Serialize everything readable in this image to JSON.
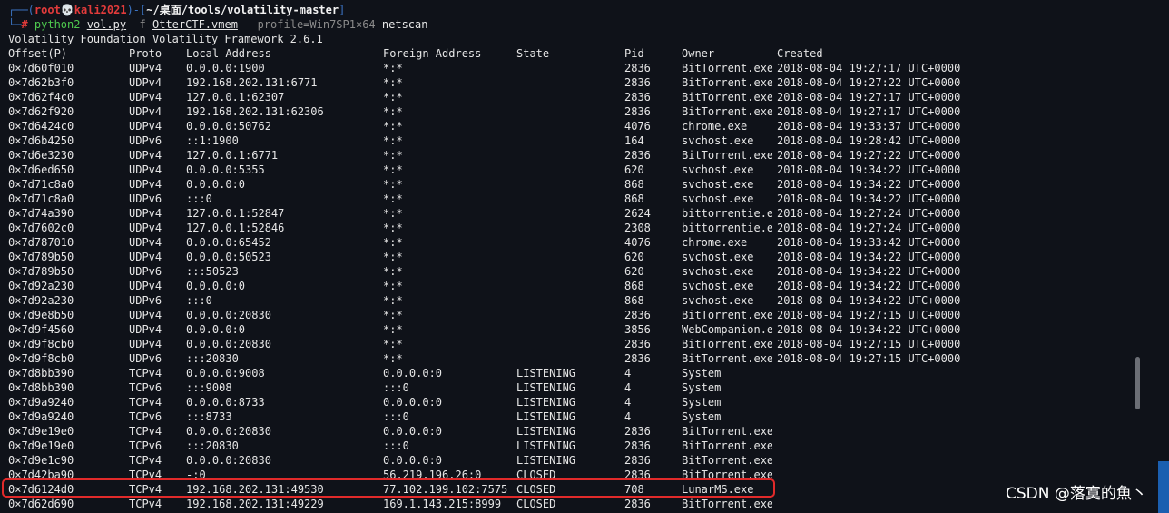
{
  "prompt": {
    "frame_top": "┌──(",
    "user": "root",
    "skull": "💀",
    "host": "kali2021",
    "sep": ")-[",
    "path": "~/桌面/tools/volatility-master",
    "frame_close": "]",
    "frame_bottom": "└─",
    "hash": "# ",
    "cmd_python": "python2",
    "cmd_script": "vol.py",
    "cmd_flag": "-f",
    "cmd_file": "OtterCTF.vmem",
    "cmd_profile": "--profile=Win7SP1×64",
    "cmd_plugin": "netscan"
  },
  "banner": "Volatility Foundation Volatility Framework 2.6.1",
  "table": {
    "headers": {
      "offset": "Offset(P)",
      "proto": "Proto",
      "local": "Local Address",
      "foreign": "Foreign Address",
      "state": "State",
      "pid": "Pid",
      "owner": "Owner",
      "created": "Created"
    },
    "rows": [
      {
        "offset": "0×7d60f010",
        "proto": "UDPv4",
        "local": "0.0.0.0:1900",
        "foreign": "*:*",
        "state": "",
        "pid": "2836",
        "owner": "BitTorrent.exe",
        "created": "2018-08-04 19:27:17 UTC+0000"
      },
      {
        "offset": "0×7d62b3f0",
        "proto": "UDPv4",
        "local": "192.168.202.131:6771",
        "foreign": "*:*",
        "state": "",
        "pid": "2836",
        "owner": "BitTorrent.exe",
        "created": "2018-08-04 19:27:22 UTC+0000"
      },
      {
        "offset": "0×7d62f4c0",
        "proto": "UDPv4",
        "local": "127.0.0.1:62307",
        "foreign": "*:*",
        "state": "",
        "pid": "2836",
        "owner": "BitTorrent.exe",
        "created": "2018-08-04 19:27:17 UTC+0000"
      },
      {
        "offset": "0×7d62f920",
        "proto": "UDPv4",
        "local": "192.168.202.131:62306",
        "foreign": "*:*",
        "state": "",
        "pid": "2836",
        "owner": "BitTorrent.exe",
        "created": "2018-08-04 19:27:17 UTC+0000"
      },
      {
        "offset": "0×7d6424c0",
        "proto": "UDPv4",
        "local": "0.0.0.0:50762",
        "foreign": "*:*",
        "state": "",
        "pid": "4076",
        "owner": "chrome.exe",
        "created": "2018-08-04 19:33:37 UTC+0000"
      },
      {
        "offset": "0×7d6b4250",
        "proto": "UDPv6",
        "local": "::1:1900",
        "foreign": "*:*",
        "state": "",
        "pid": "164",
        "owner": "svchost.exe",
        "created": "2018-08-04 19:28:42 UTC+0000"
      },
      {
        "offset": "0×7d6e3230",
        "proto": "UDPv4",
        "local": "127.0.0.1:6771",
        "foreign": "*:*",
        "state": "",
        "pid": "2836",
        "owner": "BitTorrent.exe",
        "created": "2018-08-04 19:27:22 UTC+0000"
      },
      {
        "offset": "0×7d6ed650",
        "proto": "UDPv4",
        "local": "0.0.0.0:5355",
        "foreign": "*:*",
        "state": "",
        "pid": "620",
        "owner": "svchost.exe",
        "created": "2018-08-04 19:34:22 UTC+0000"
      },
      {
        "offset": "0×7d71c8a0",
        "proto": "UDPv4",
        "local": "0.0.0.0:0",
        "foreign": "*:*",
        "state": "",
        "pid": "868",
        "owner": "svchost.exe",
        "created": "2018-08-04 19:34:22 UTC+0000"
      },
      {
        "offset": "0×7d71c8a0",
        "proto": "UDPv6",
        "local": ":::0",
        "foreign": "*:*",
        "state": "",
        "pid": "868",
        "owner": "svchost.exe",
        "created": "2018-08-04 19:34:22 UTC+0000"
      },
      {
        "offset": "0×7d74a390",
        "proto": "UDPv4",
        "local": "127.0.0.1:52847",
        "foreign": "*:*",
        "state": "",
        "pid": "2624",
        "owner": "bittorrentie.exe",
        "created": "2018-08-04 19:27:24 UTC+0000"
      },
      {
        "offset": "0×7d7602c0",
        "proto": "UDPv4",
        "local": "127.0.0.1:52846",
        "foreign": "*:*",
        "state": "",
        "pid": "2308",
        "owner": "bittorrentie.exe",
        "created": "2018-08-04 19:27:24 UTC+0000"
      },
      {
        "offset": "0×7d787010",
        "proto": "UDPv4",
        "local": "0.0.0.0:65452",
        "foreign": "*:*",
        "state": "",
        "pid": "4076",
        "owner": "chrome.exe",
        "created": "2018-08-04 19:33:42 UTC+0000"
      },
      {
        "offset": "0×7d789b50",
        "proto": "UDPv4",
        "local": "0.0.0.0:50523",
        "foreign": "*:*",
        "state": "",
        "pid": "620",
        "owner": "svchost.exe",
        "created": "2018-08-04 19:34:22 UTC+0000"
      },
      {
        "offset": "0×7d789b50",
        "proto": "UDPv6",
        "local": ":::50523",
        "foreign": "*:*",
        "state": "",
        "pid": "620",
        "owner": "svchost.exe",
        "created": "2018-08-04 19:34:22 UTC+0000"
      },
      {
        "offset": "0×7d92a230",
        "proto": "UDPv4",
        "local": "0.0.0.0:0",
        "foreign": "*:*",
        "state": "",
        "pid": "868",
        "owner": "svchost.exe",
        "created": "2018-08-04 19:34:22 UTC+0000"
      },
      {
        "offset": "0×7d92a230",
        "proto": "UDPv6",
        "local": ":::0",
        "foreign": "*:*",
        "state": "",
        "pid": "868",
        "owner": "svchost.exe",
        "created": "2018-08-04 19:34:22 UTC+0000"
      },
      {
        "offset": "0×7d9e8b50",
        "proto": "UDPv4",
        "local": "0.0.0.0:20830",
        "foreign": "*:*",
        "state": "",
        "pid": "2836",
        "owner": "BitTorrent.exe",
        "created": "2018-08-04 19:27:15 UTC+0000"
      },
      {
        "offset": "0×7d9f4560",
        "proto": "UDPv4",
        "local": "0.0.0.0:0",
        "foreign": "*:*",
        "state": "",
        "pid": "3856",
        "owner": "WebCompanion.exe",
        "created": "2018-08-04 19:34:22 UTC+0000"
      },
      {
        "offset": "0×7d9f8cb0",
        "proto": "UDPv4",
        "local": "0.0.0.0:20830",
        "foreign": "*:*",
        "state": "",
        "pid": "2836",
        "owner": "BitTorrent.exe",
        "created": "2018-08-04 19:27:15 UTC+0000"
      },
      {
        "offset": "0×7d9f8cb0",
        "proto": "UDPv6",
        "local": ":::20830",
        "foreign": "*:*",
        "state": "",
        "pid": "2836",
        "owner": "BitTorrent.exe",
        "created": "2018-08-04 19:27:15 UTC+0000"
      },
      {
        "offset": "0×7d8bb390",
        "proto": "TCPv4",
        "local": "0.0.0.0:9008",
        "foreign": "0.0.0.0:0",
        "state": "LISTENING",
        "pid": "4",
        "owner": "System",
        "created": ""
      },
      {
        "offset": "0×7d8bb390",
        "proto": "TCPv6",
        "local": ":::9008",
        "foreign": ":::0",
        "state": "LISTENING",
        "pid": "4",
        "owner": "System",
        "created": ""
      },
      {
        "offset": "0×7d9a9240",
        "proto": "TCPv4",
        "local": "0.0.0.0:8733",
        "foreign": "0.0.0.0:0",
        "state": "LISTENING",
        "pid": "4",
        "owner": "System",
        "created": ""
      },
      {
        "offset": "0×7d9a9240",
        "proto": "TCPv6",
        "local": ":::8733",
        "foreign": ":::0",
        "state": "LISTENING",
        "pid": "4",
        "owner": "System",
        "created": ""
      },
      {
        "offset": "0×7d9e19e0",
        "proto": "TCPv4",
        "local": "0.0.0.0:20830",
        "foreign": "0.0.0.0:0",
        "state": "LISTENING",
        "pid": "2836",
        "owner": "BitTorrent.exe",
        "created": ""
      },
      {
        "offset": "0×7d9e19e0",
        "proto": "TCPv6",
        "local": ":::20830",
        "foreign": ":::0",
        "state": "LISTENING",
        "pid": "2836",
        "owner": "BitTorrent.exe",
        "created": ""
      },
      {
        "offset": "0×7d9e1c90",
        "proto": "TCPv4",
        "local": "0.0.0.0:20830",
        "foreign": "0.0.0.0:0",
        "state": "LISTENING",
        "pid": "2836",
        "owner": "BitTorrent.exe",
        "created": ""
      },
      {
        "offset": "0×7d42ba90",
        "proto": "TCPv4",
        "local": "-:0",
        "foreign": "56.219.196.26:0",
        "state": "CLOSED",
        "pid": "2836",
        "owner": "BitTorrent.exe",
        "created": ""
      },
      {
        "offset": "0×7d6124d0",
        "proto": "TCPv4",
        "local": "192.168.202.131:49530",
        "foreign": "77.102.199.102:7575",
        "state": "CLOSED",
        "pid": "708",
        "owner": "LunarMS.exe",
        "created": ""
      },
      {
        "offset": "0×7d62d690",
        "proto": "TCPv4",
        "local": "192.168.202.131:49229",
        "foreign": "169.1.143.215:8999",
        "state": "CLOSED",
        "pid": "2836",
        "owner": "BitTorrent.exe",
        "created": ""
      }
    ]
  },
  "watermark": "CSDN @落寞的魚丶"
}
